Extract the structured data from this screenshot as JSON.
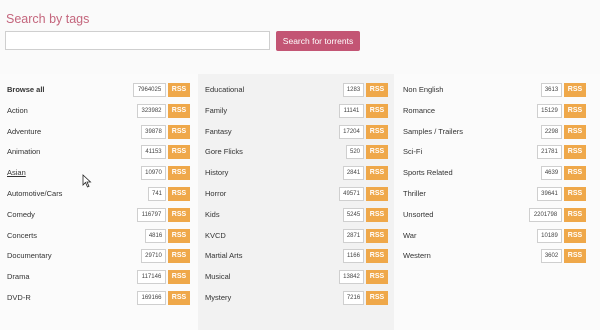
{
  "search": {
    "title": "Search by tags",
    "placeholder": "",
    "value": "",
    "button_label": "Search for torrents"
  },
  "rss_label": "RSS",
  "colors": {
    "accent": "#c35574",
    "title": "#c4667d",
    "rss": "#efa84a"
  },
  "columns": [
    [
      {
        "name": "Browse all",
        "count": "7964025",
        "bold": true
      },
      {
        "name": "Action",
        "count": "323982"
      },
      {
        "name": "Adventure",
        "count": "39878"
      },
      {
        "name": "Animation",
        "count": "41153"
      },
      {
        "name": "Asian",
        "count": "10970",
        "underline": true
      },
      {
        "name": "Automotive/Cars",
        "count": "741"
      },
      {
        "name": "Comedy",
        "count": "116797"
      },
      {
        "name": "Concerts",
        "count": "4816"
      },
      {
        "name": "Documentary",
        "count": "29710"
      },
      {
        "name": "Drama",
        "count": "117146"
      },
      {
        "name": "DVD-R",
        "count": "169166"
      }
    ],
    [
      {
        "name": "Educational",
        "count": "1283"
      },
      {
        "name": "Family",
        "count": "11141"
      },
      {
        "name": "Fantasy",
        "count": "17204"
      },
      {
        "name": "Gore Flicks",
        "count": "520"
      },
      {
        "name": "History",
        "count": "2841"
      },
      {
        "name": "Horror",
        "count": "49571"
      },
      {
        "name": "Kids",
        "count": "5245"
      },
      {
        "name": "KVCD",
        "count": "2871"
      },
      {
        "name": "Martial Arts",
        "count": "1166"
      },
      {
        "name": "Musical",
        "count": "13842"
      },
      {
        "name": "Mystery",
        "count": "7216"
      }
    ],
    [
      {
        "name": "Non English",
        "count": "3613"
      },
      {
        "name": "Romance",
        "count": "15129"
      },
      {
        "name": "Samples / Trailers",
        "count": "2298"
      },
      {
        "name": "Sci-Fi",
        "count": "21781"
      },
      {
        "name": "Sports Related",
        "count": "4639"
      },
      {
        "name": "Thriller",
        "count": "39641"
      },
      {
        "name": "Unsorted",
        "count": "2201798"
      },
      {
        "name": "War",
        "count": "10189"
      },
      {
        "name": "Western",
        "count": "3602"
      }
    ]
  ]
}
